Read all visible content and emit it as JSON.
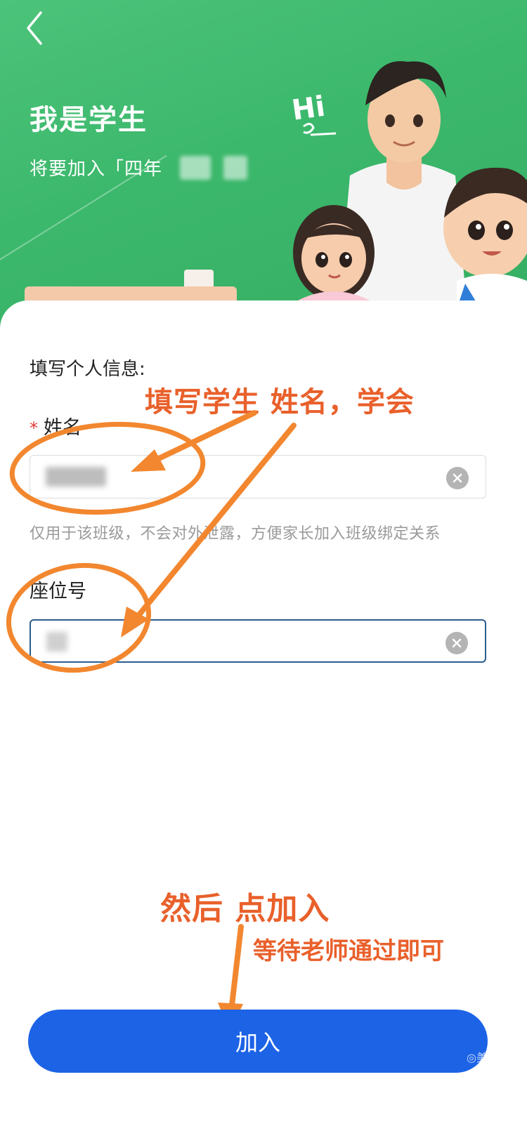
{
  "header": {
    "title": "我是学生",
    "subtitle": "将要加入「四年",
    "hi_text": "Hi"
  },
  "form": {
    "section_label": "填写个人信息:",
    "name_field": {
      "required_mark": "*",
      "label": "姓名",
      "hint": "仅用于该班级，不会对外泄露，方便家长加入班级绑定关系"
    },
    "seat_field": {
      "label": "座位号"
    }
  },
  "annotations": {
    "fill_name": "填写学生  姓名，学会",
    "then_join": "然后 点加入",
    "wait_teacher": "等待老师通过即可"
  },
  "actions": {
    "join_label": "加入"
  },
  "watermark": "美篇",
  "colors": {
    "banner_green": "#3cb86c",
    "join_blue": "#1c63e6",
    "annotation_orange": "#f2872f"
  }
}
